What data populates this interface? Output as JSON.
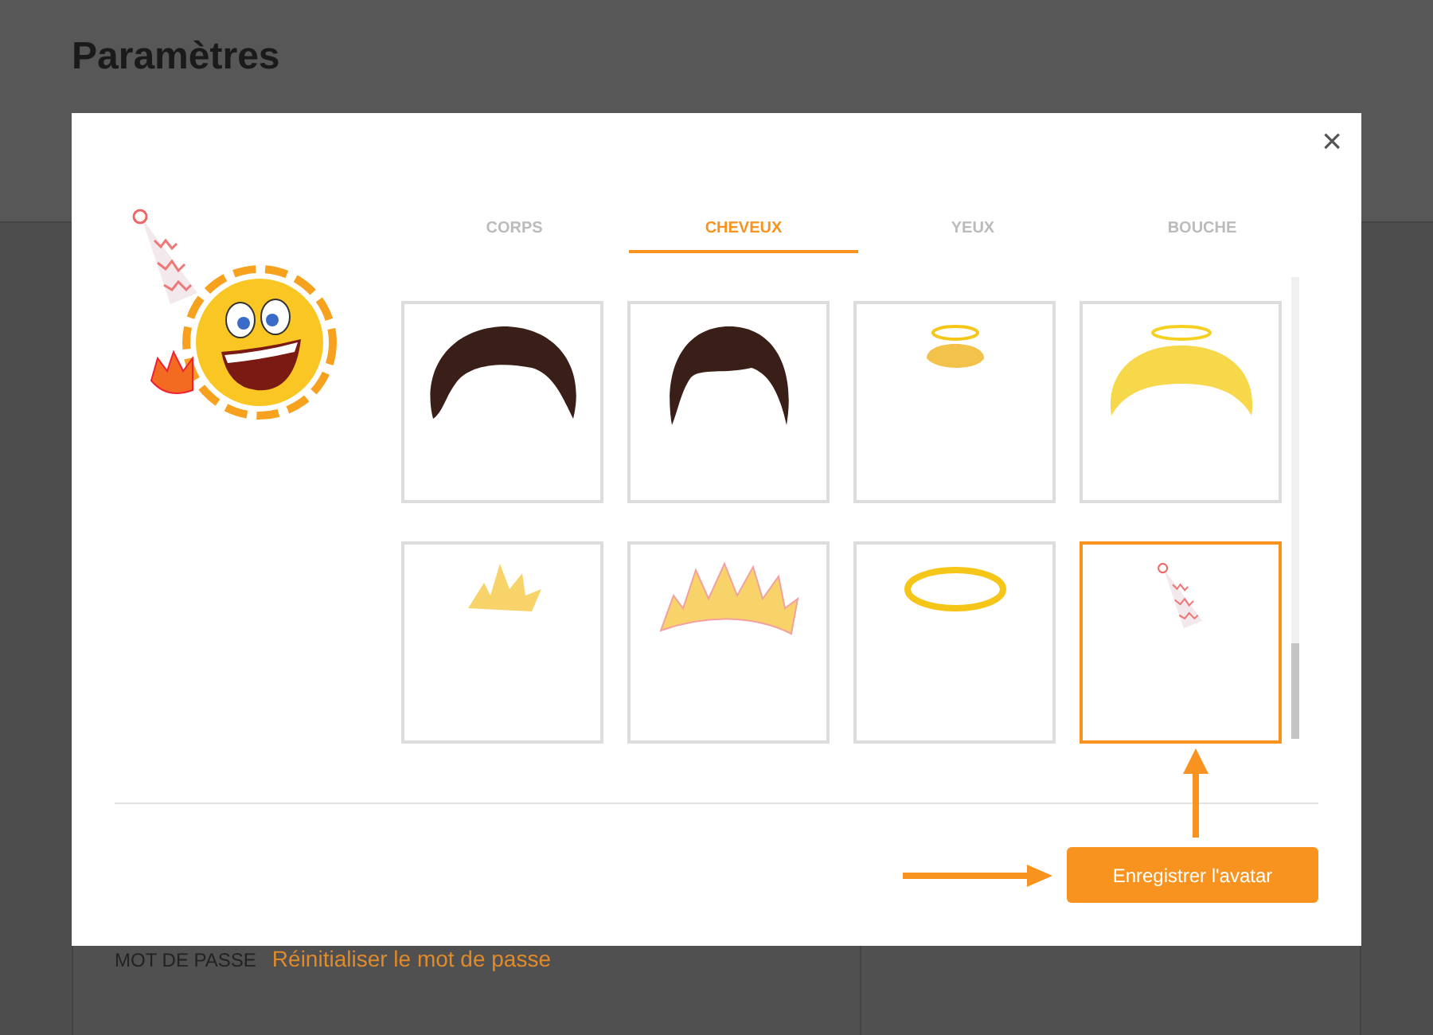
{
  "page": {
    "title": "Paramètres",
    "password_label": "MOT DE PASSE",
    "password_link": "Réinitialiser le mot de passe"
  },
  "modal": {
    "close": "×",
    "tabs": [
      {
        "label": "CORPS",
        "selected": false
      },
      {
        "label": "CHEVEUX",
        "selected": true
      },
      {
        "label": "YEUX",
        "selected": false
      },
      {
        "label": "BOUCHE",
        "selected": false
      }
    ],
    "items": [
      {
        "selected": false
      },
      {
        "selected": false
      },
      {
        "selected": false
      },
      {
        "selected": false
      },
      {
        "selected": false
      },
      {
        "selected": false
      },
      {
        "selected": false
      },
      {
        "selected": true
      }
    ],
    "save_button": "Enregistrer l'avatar"
  }
}
